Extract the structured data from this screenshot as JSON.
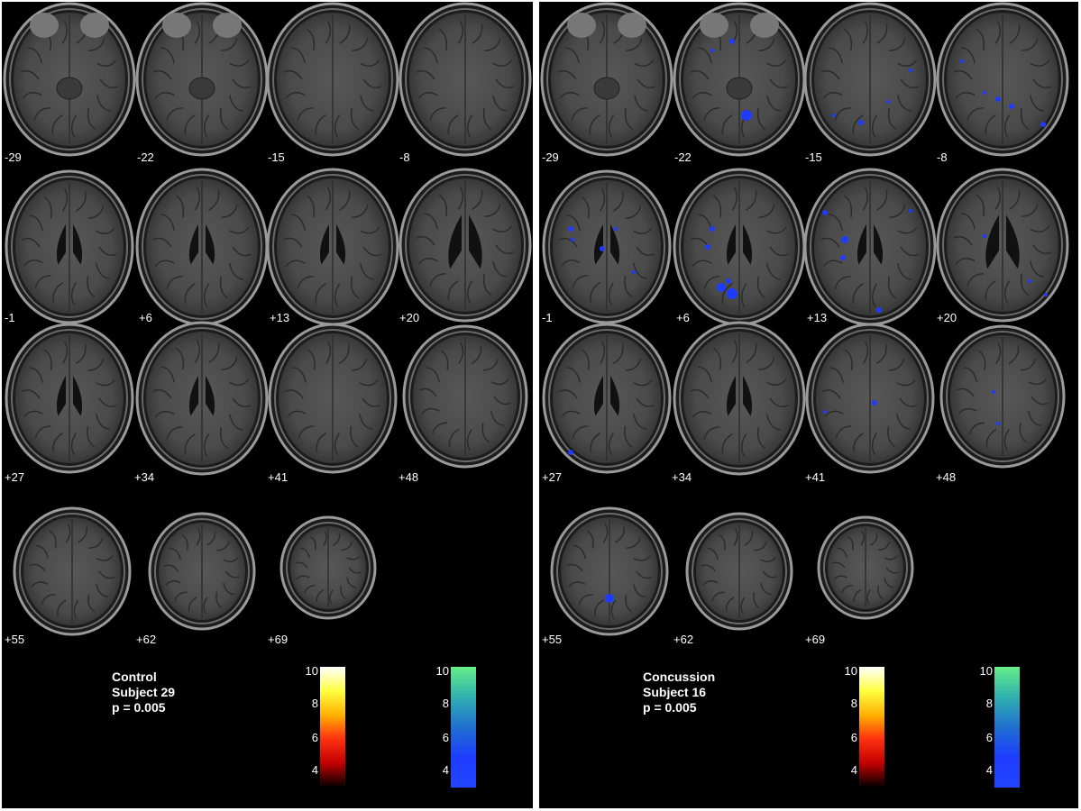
{
  "panels": [
    {
      "id": "control",
      "info": [
        "Control",
        "Subject 29",
        "p = 0.005"
      ],
      "slices": [
        "-29",
        "-22",
        "-15",
        "-8",
        "-1",
        "+6",
        "+13",
        "+20",
        "+27",
        "+34",
        "+41",
        "+48",
        "+55",
        "+62",
        "+69"
      ],
      "has_blobs": false
    },
    {
      "id": "concussion",
      "info": [
        "Concussion",
        "Subject 16",
        "p = 0.005"
      ],
      "slices": [
        "-29",
        "-22",
        "-15",
        "-8",
        "-1",
        "+6",
        "+13",
        "+20",
        "+27",
        "+34",
        "+41",
        "+48",
        "+55",
        "+62",
        "+69"
      ],
      "has_blobs": true
    }
  ],
  "colorbars": {
    "hot": {
      "ticks": [
        "10",
        "8",
        "6",
        "4"
      ],
      "colors": [
        "#ffffff",
        "#ffff40",
        "#ffb000",
        "#ff3010",
        "#c00000",
        "#000000"
      ]
    },
    "cool": {
      "ticks": [
        "10",
        "8",
        "6",
        "4"
      ],
      "colors": [
        "#66ee88",
        "#30b0b0",
        "#2070d0",
        "#1e3cff",
        "#2244ff"
      ]
    }
  },
  "colors": {
    "background": "#000000",
    "blob": "#1e3cff",
    "separator": "#ffffff"
  }
}
